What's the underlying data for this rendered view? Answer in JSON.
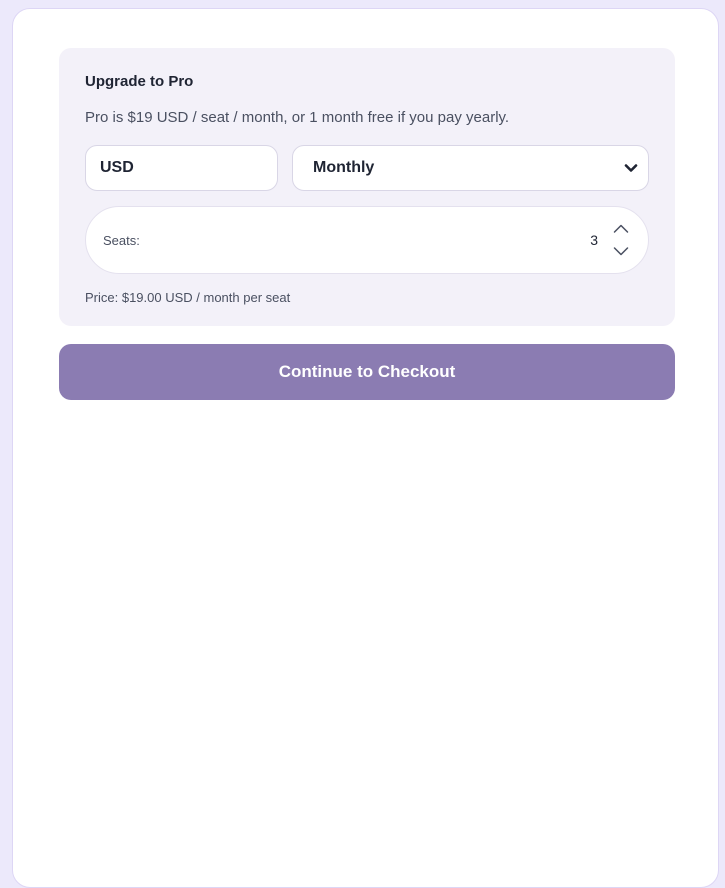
{
  "upgrade": {
    "title": "Upgrade to Pro",
    "description": "Pro is $19 USD / seat / month, or 1 month free if you pay yearly.",
    "currency_value": "USD",
    "billing_value": "Monthly",
    "seats": {
      "label": "Seats:",
      "value": "3"
    },
    "price_text": "Price: $19.00 USD / month per seat"
  },
  "checkout": {
    "label": "Continue to Checkout"
  },
  "colors": {
    "page_background": "#ece9fb",
    "panel_background": "#f3f1f9",
    "button_accent": "#8b7cb2"
  },
  "icons": {
    "select_arrow": "chevron-down-icon",
    "seat_spinner": "stepper-arrows-icon"
  }
}
